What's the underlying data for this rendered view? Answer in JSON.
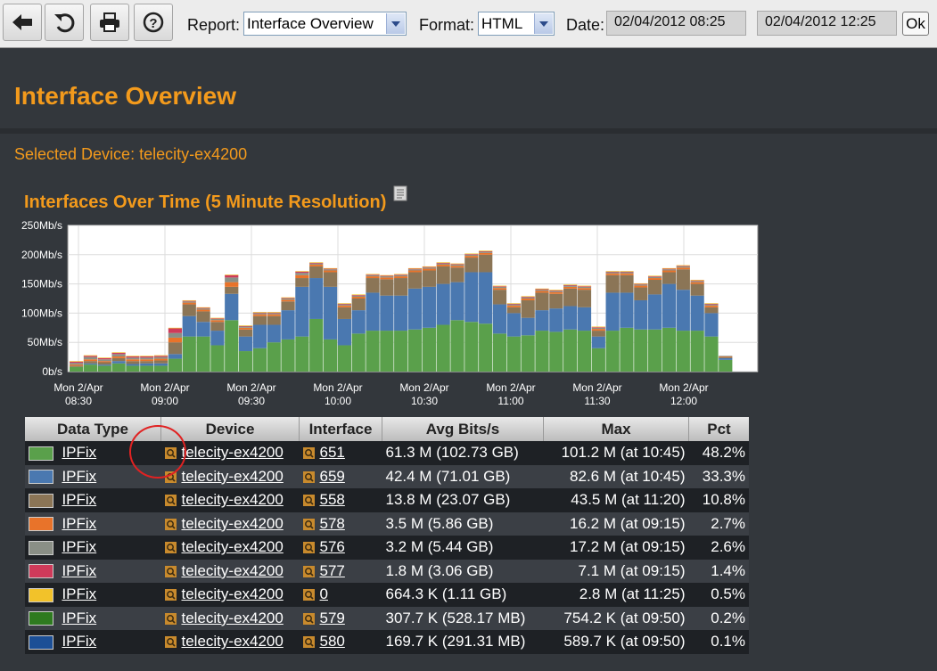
{
  "toolbar": {
    "report_label": "Report:",
    "report_value": "Interface Overview",
    "format_label": "Format:",
    "format_value": "HTML",
    "date_label": "Date:",
    "date_start": "02/04/2012 08:25",
    "date_end": "02/04/2012 12:25",
    "ok_label": "Ok",
    "icons": [
      "back-icon",
      "refresh-icon",
      "print-icon",
      "help-icon"
    ]
  },
  "page": {
    "title": "Interface Overview",
    "selected_device": "Selected Device: telecity-ex4200",
    "chart_heading": "Interfaces Over Time  (5 Minute Resolution)"
  },
  "chart_data": {
    "type": "area",
    "title": "Interfaces Over Time  (5 Minute Resolution)",
    "y_ticks": [
      "250Mb/s",
      "200Mb/s",
      "150Mb/s",
      "100Mb/s",
      "50Mb/s",
      "0b/s"
    ],
    "ylim": [
      0,
      250
    ],
    "x_ticks": [
      [
        "Mon 2/Apr",
        "08:30"
      ],
      [
        "Mon 2/Apr",
        "09:00"
      ],
      [
        "Mon 2/Apr",
        "09:30"
      ],
      [
        "Mon 2/Apr",
        "10:00"
      ],
      [
        "Mon 2/Apr",
        "10:30"
      ],
      [
        "Mon 2/Apr",
        "11:00"
      ],
      [
        "Mon 2/Apr",
        "11:30"
      ],
      [
        "Mon 2/Apr",
        "12:00"
      ]
    ],
    "x_start": "08:25",
    "step_minutes": 5,
    "series": [
      {
        "name": "651",
        "color": "#5aa04b",
        "values": [
          8,
          12,
          10,
          14,
          10,
          10,
          10,
          22,
          60,
          60,
          45,
          88,
          35,
          40,
          50,
          55,
          60,
          90,
          55,
          45,
          65,
          70,
          70,
          70,
          72,
          75,
          80,
          88,
          85,
          82,
          65,
          60,
          62,
          70,
          68,
          72,
          70,
          40,
          70,
          75,
          72,
          72,
          75,
          70,
          70,
          60,
          20
        ]
      },
      {
        "name": "659",
        "color": "#4a78b0",
        "values": [
          0,
          2,
          2,
          4,
          3,
          4,
          4,
          8,
          35,
          25,
          25,
          45,
          25,
          40,
          30,
          50,
          85,
          70,
          90,
          45,
          40,
          65,
          60,
          60,
          70,
          70,
          70,
          65,
          85,
          88,
          50,
          40,
          30,
          35,
          40,
          40,
          40,
          20,
          65,
          60,
          50,
          60,
          75,
          70,
          60,
          40,
          3
        ]
      },
      {
        "name": "558",
        "color": "#8b7556",
        "values": [
          2,
          4,
          4,
          5,
          5,
          4,
          5,
          20,
          20,
          18,
          15,
          12,
          12,
          15,
          15,
          15,
          15,
          20,
          25,
          20,
          20,
          25,
          28,
          30,
          28,
          28,
          30,
          25,
          25,
          30,
          25,
          10,
          30,
          30,
          25,
          30,
          30,
          10,
          30,
          30,
          22,
          25,
          20,
          35,
          20,
          10,
          2
        ]
      },
      {
        "name": "578",
        "color": "#e8732a",
        "values": [
          2,
          3,
          2,
          3,
          3,
          3,
          3,
          8,
          3,
          3,
          3,
          8,
          3,
          3,
          3,
          3,
          5,
          3,
          3,
          3,
          3,
          3,
          3,
          3,
          3,
          3,
          3,
          3,
          3,
          3,
          3,
          3,
          3,
          3,
          3,
          3,
          3,
          3,
          3,
          3,
          3,
          3,
          3,
          3,
          3,
          3,
          1
        ]
      },
      {
        "name": "576",
        "color": "#8a8f86",
        "values": [
          3,
          4,
          3,
          4,
          3,
          3,
          3,
          8,
          2,
          2,
          2,
          8,
          2,
          2,
          2,
          2,
          4,
          2,
          2,
          2,
          2,
          2,
          2,
          2,
          2,
          2,
          2,
          2,
          2,
          2,
          2,
          2,
          2,
          2,
          2,
          2,
          2,
          2,
          2,
          2,
          2,
          2,
          2,
          2,
          2,
          2,
          1
        ]
      },
      {
        "name": "577",
        "color": "#cf3a5a",
        "values": [
          2,
          2,
          2,
          2,
          2,
          2,
          2,
          8,
          1,
          1,
          1,
          4,
          1,
          1,
          1,
          1,
          2,
          1,
          1,
          1,
          1,
          1,
          1,
          1,
          1,
          1,
          1,
          1,
          1,
          1,
          1,
          1,
          1,
          1,
          1,
          1,
          1,
          1,
          1,
          1,
          1,
          1,
          1,
          1,
          1,
          1,
          0
        ]
      },
      {
        "name": "0",
        "color": "#f2c22a",
        "values": [
          1,
          1,
          1,
          1,
          1,
          1,
          1,
          1,
          1,
          1,
          1,
          1,
          1,
          1,
          1,
          1,
          1,
          1,
          1,
          1,
          1,
          1,
          1,
          1,
          1,
          1,
          1,
          1,
          1,
          1,
          1,
          1,
          1,
          1,
          1,
          1,
          1,
          1,
          1,
          1,
          1,
          1,
          1,
          1,
          1,
          1,
          0
        ]
      }
    ]
  },
  "table": {
    "headers": [
      "Data Type",
      "Device",
      "Interface",
      "Avg Bits/s",
      "Max",
      "Pct"
    ],
    "rows": [
      {
        "color": "#5aa04b",
        "type": "IPFix",
        "device": "telecity-ex4200",
        "iface": "651",
        "avg": "61.3 M (102.73 GB)",
        "max": "101.2 M (at 10:45)",
        "pct": "48.2%"
      },
      {
        "color": "#4a78b0",
        "type": "IPFix",
        "device": "telecity-ex4200",
        "iface": "659",
        "avg": "42.4 M (71.01 GB)",
        "max": "82.6 M (at 10:45)",
        "pct": "33.3%"
      },
      {
        "color": "#8b7556",
        "type": "IPFix",
        "device": "telecity-ex4200",
        "iface": "558",
        "avg": "13.8 M (23.07 GB)",
        "max": "43.5 M (at 11:20)",
        "pct": "10.8%"
      },
      {
        "color": "#e8732a",
        "type": "IPFix",
        "device": "telecity-ex4200",
        "iface": "578",
        "avg": "3.5 M (5.86 GB)",
        "max": "16.2 M (at 09:15)",
        "pct": "2.7%"
      },
      {
        "color": "#8a8f86",
        "type": "IPFix",
        "device": "telecity-ex4200",
        "iface": "576",
        "avg": "3.2 M (5.44 GB)",
        "max": "17.2 M (at 09:15)",
        "pct": "2.6%"
      },
      {
        "color": "#cf3a5a",
        "type": "IPFix",
        "device": "telecity-ex4200",
        "iface": "577",
        "avg": "1.8 M (3.06 GB)",
        "max": "7.1 M (at 09:15)",
        "pct": "1.4%"
      },
      {
        "color": "#f2c22a",
        "type": "IPFix",
        "device": "telecity-ex4200",
        "iface": "0",
        "avg": "664.3 K (1.11 GB)",
        "max": "2.8 M (at 11:25)",
        "pct": "0.5%"
      },
      {
        "color": "#2e7a1f",
        "type": "IPFix",
        "device": "telecity-ex4200",
        "iface": "579",
        "avg": "307.7 K (528.17 MB)",
        "max": "754.2 K (at 09:50)",
        "pct": "0.2%"
      },
      {
        "color": "#1c4f96",
        "type": "IPFix",
        "device": "telecity-ex4200",
        "iface": "580",
        "avg": "169.7 K (291.31 MB)",
        "max": "589.7 K (at 09:50)",
        "pct": "0.1%"
      }
    ]
  }
}
